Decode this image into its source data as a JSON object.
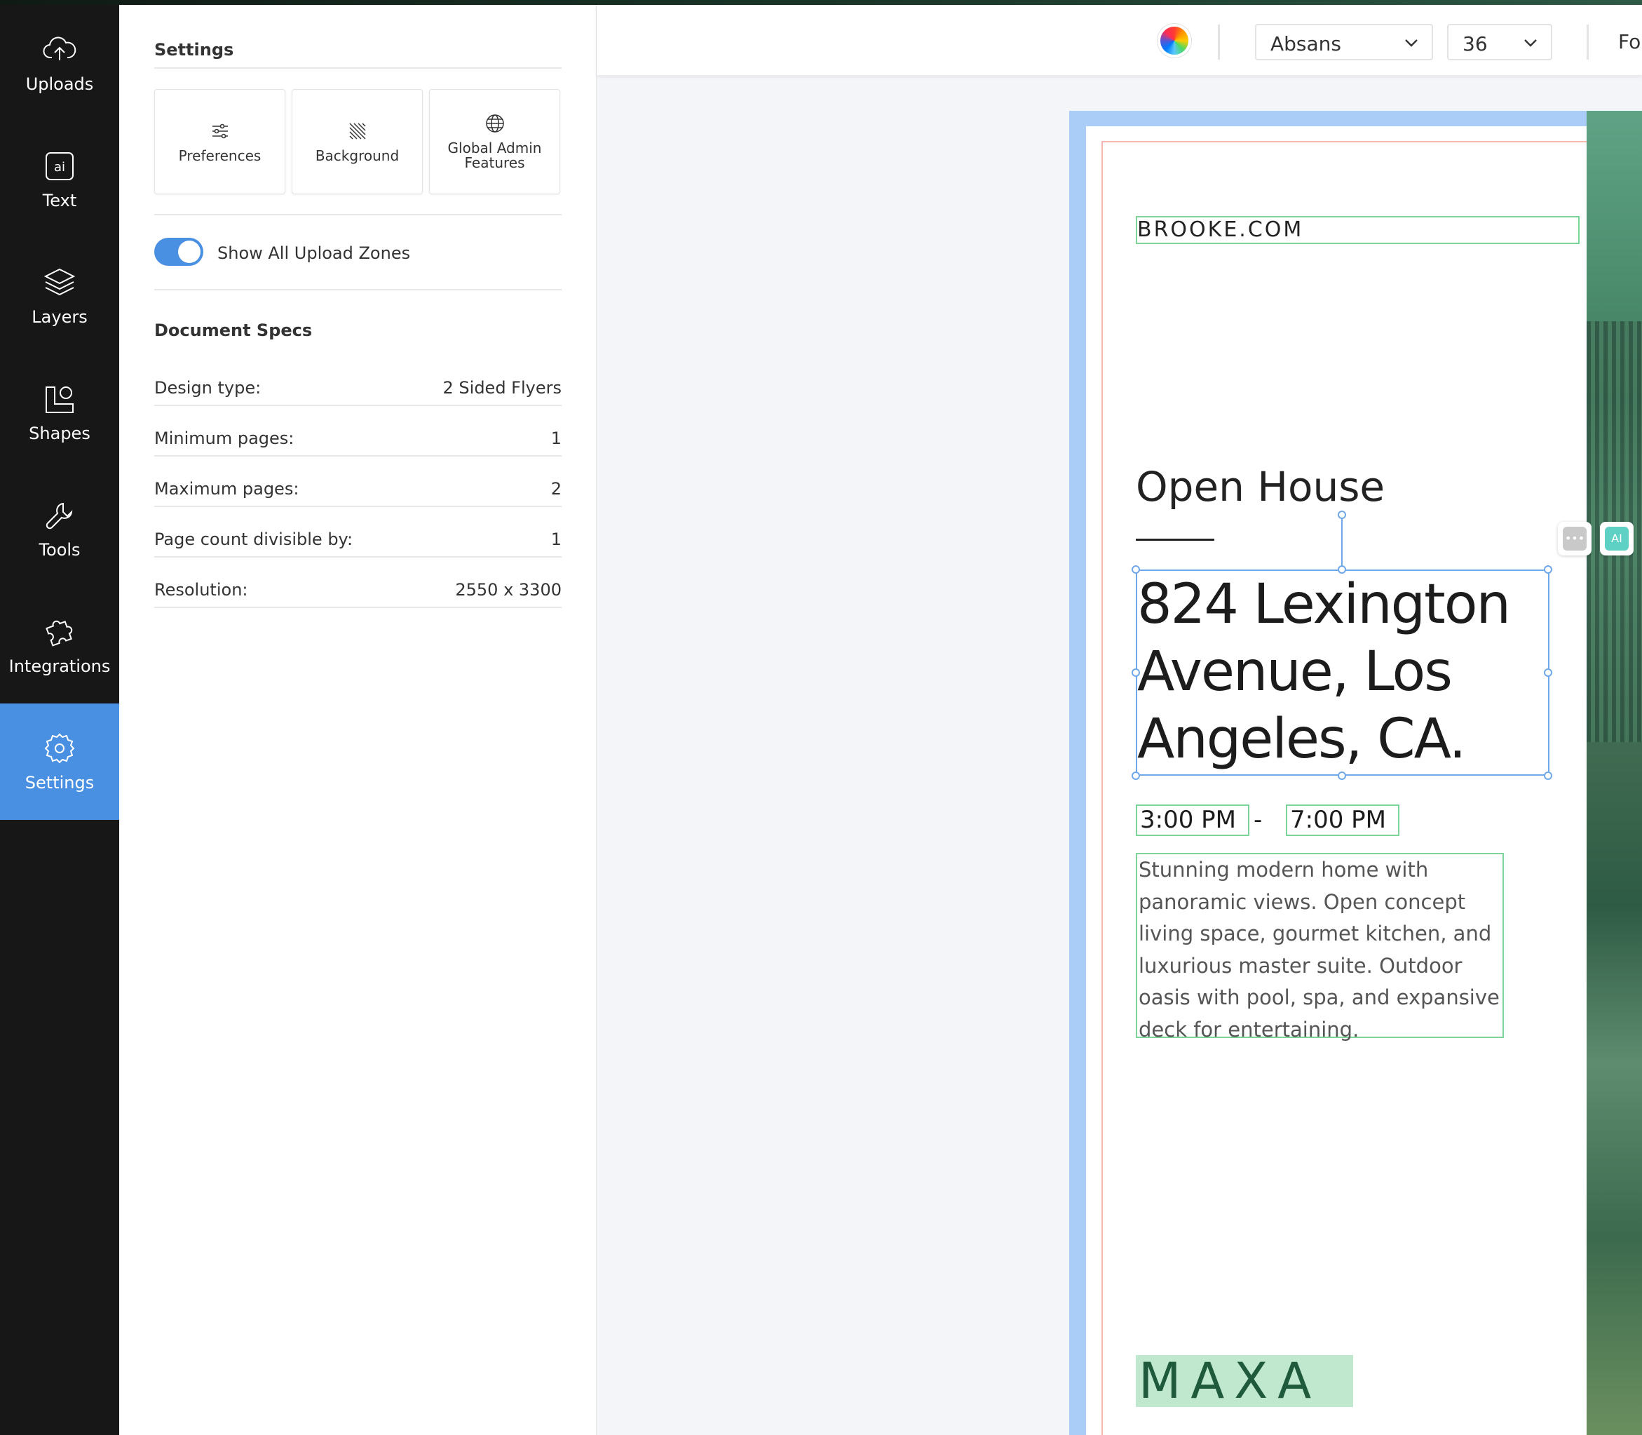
{
  "nav": {
    "items": [
      {
        "label": "Uploads",
        "icon": "cloud-upload-icon"
      },
      {
        "label": "Text",
        "icon": "ai-text-icon",
        "glyph": "ai"
      },
      {
        "label": "Layers",
        "icon": "layers-icon"
      },
      {
        "label": "Shapes",
        "icon": "shapes-icon"
      },
      {
        "label": "Tools",
        "icon": "wrench-icon"
      },
      {
        "label": "Integrations",
        "icon": "puzzle-icon"
      },
      {
        "label": "Settings",
        "icon": "gear-icon",
        "active": true
      }
    ],
    "active_color": "#4a90e2"
  },
  "settings": {
    "title": "Settings",
    "cards": [
      {
        "label": "Preferences",
        "icon": "sliders-icon"
      },
      {
        "label": "Background",
        "icon": "hatch-pattern-icon"
      },
      {
        "label": "Global Admin Features",
        "icon": "globe-icon"
      }
    ],
    "toggle": {
      "label": "Show All Upload Zones",
      "on": true
    },
    "specs_title": "Document Specs",
    "specs": [
      {
        "key": "Design type:",
        "value": "2 Sided Flyers"
      },
      {
        "key": "Minimum pages:",
        "value": "1"
      },
      {
        "key": "Maximum pages:",
        "value": "2"
      },
      {
        "key": "Page count divisible by:",
        "value": "1"
      },
      {
        "key": "Resolution:",
        "value": "2550 x 3300"
      }
    ]
  },
  "toolbar": {
    "font": "Absans",
    "font_size": "36",
    "truncated_label": "Fo"
  },
  "canvas": {
    "website": "BROOKE.COM",
    "heading": "Open House",
    "address_lines": [
      "824 Lexington",
      "Avenue, Los",
      "Angeles, CA."
    ],
    "time_start": "3:00 PM",
    "time_separator": "-",
    "time_end": "7:00 PM",
    "description": "Stunning modern home with panoramic views. Open concept living space, gourmet kitchen, and luxurious master suite. Outdoor oasis with pool, spa, and expansive deck for entertaining.",
    "logo": "MAXA",
    "floating_buttons": [
      {
        "label": "•••",
        "icon": "more-options-icon"
      },
      {
        "label": "AI",
        "icon": "ai-assist-icon"
      }
    ]
  }
}
